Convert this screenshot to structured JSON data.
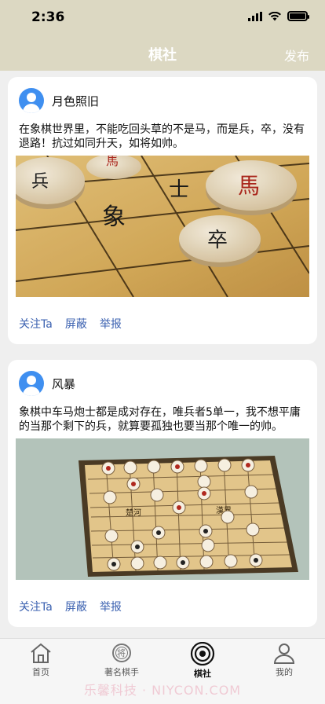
{
  "status_bar": {
    "time": "2:36"
  },
  "nav": {
    "title": "棋社",
    "action": "发布"
  },
  "posts": [
    {
      "username": "月色照旧",
      "text": "在象棋世界里，不能吃回头草的不是马，而是兵，卒，没有退路！抗过如同升天，如将如帅。",
      "image_desc": "chess-pieces-closeup",
      "actions": [
        "关注Ta",
        "屏蔽",
        "举报"
      ]
    },
    {
      "username": "风暴",
      "text": "象棋中车马炮士都是成对存在，唯兵者5单一，我不想平庸的当那个剩下的兵，就算要孤独也要当那个唯一的帅。",
      "image_desc": "chess-board-top-view",
      "actions": [
        "关注Ta",
        "屏蔽",
        "举报"
      ]
    }
  ],
  "tabs": [
    {
      "label": "首页",
      "icon": "home-icon",
      "active": false
    },
    {
      "label": "著名棋手",
      "icon": "chess-piece-icon",
      "active": false
    },
    {
      "label": "棋社",
      "icon": "club-icon",
      "active": true
    },
    {
      "label": "我的",
      "icon": "profile-icon",
      "active": false
    }
  ],
  "watermark": "乐馨科技 · NIYCON.COM",
  "colors": {
    "header": "#dcd8c2",
    "link": "#3b61b0",
    "avatar": "#3f8ff0"
  }
}
